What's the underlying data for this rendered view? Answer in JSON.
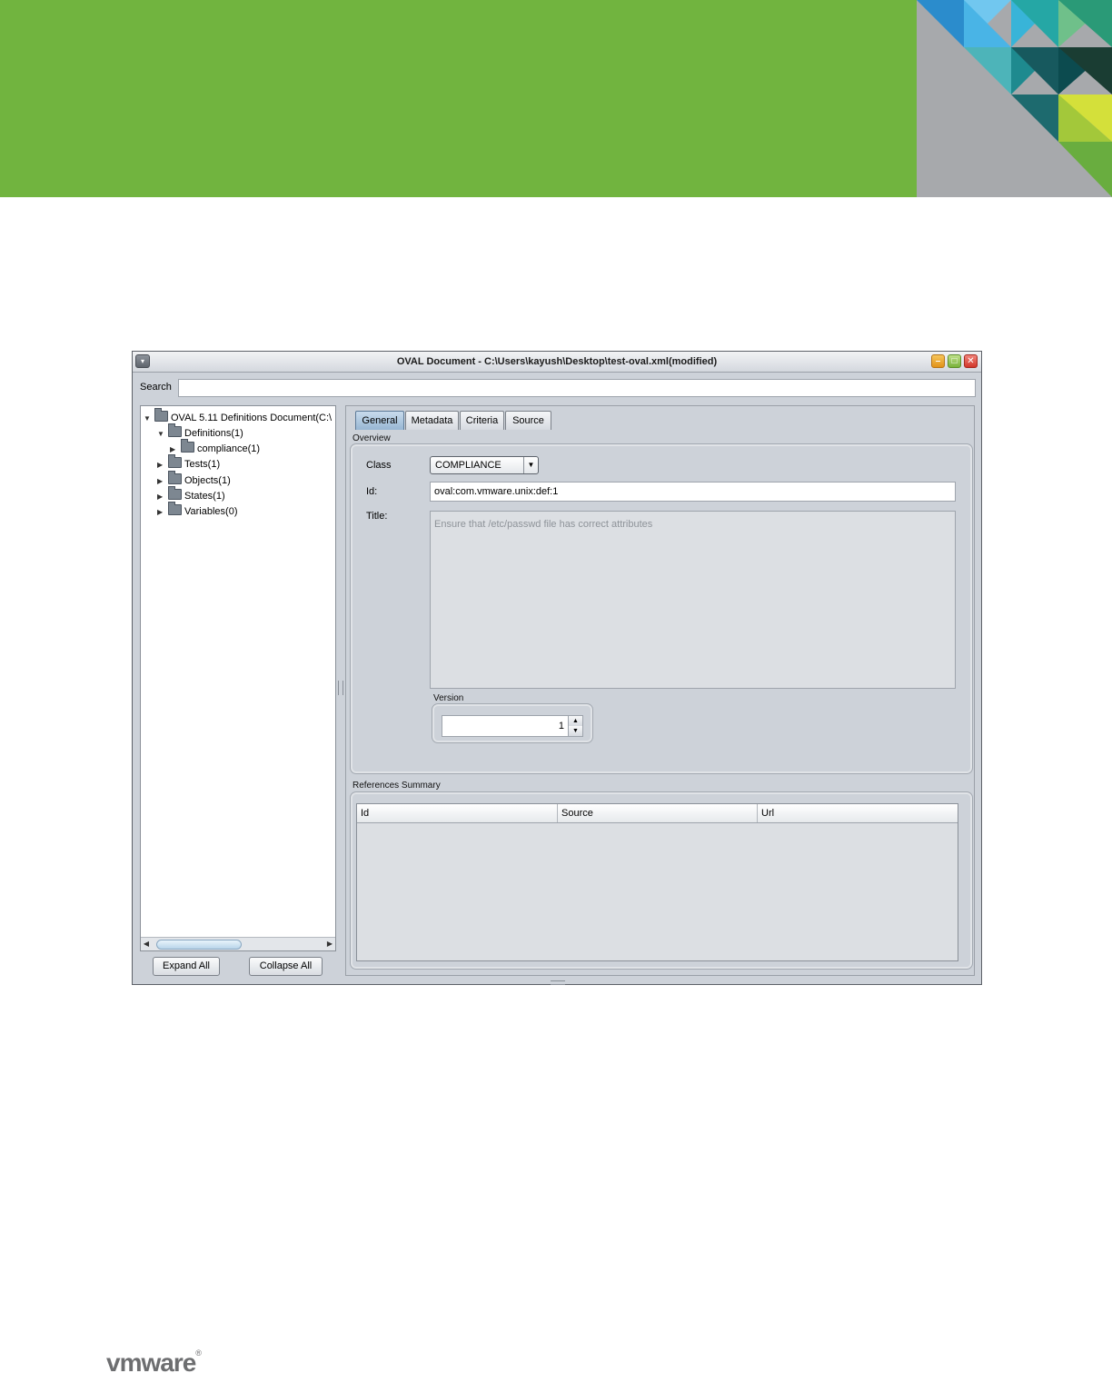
{
  "window": {
    "title": "OVAL Document - C:\\Users\\kayush\\Desktop\\test-oval.xml(modified)",
    "menu_icon": "chevron-down-icon",
    "minimize_glyph": "–",
    "maximize_glyph": "□",
    "close_glyph": "✕"
  },
  "search": {
    "label": "Search",
    "value": ""
  },
  "tree": {
    "root": "OVAL 5.11 Definitions Document(C:\\",
    "definitions": "Definitions(1)",
    "compliance": "compliance(1)",
    "tests": "Tests(1)",
    "objects": "Objects(1)",
    "states": "States(1)",
    "variables": "Variables(0)"
  },
  "buttons": {
    "expand_all": "Expand All",
    "collapse_all": "Collapse All"
  },
  "tabs": [
    "General",
    "Metadata",
    "Criteria",
    "Source"
  ],
  "overview": {
    "section": "Overview",
    "class_label": "Class",
    "class_value": "COMPLIANCE",
    "id_label": "Id:",
    "id_value": "oval:com.vmware.unix:def:1",
    "title_label": "Title:",
    "title_value": "Ensure that /etc/passwd file has correct attributes",
    "version_label": "Version",
    "version_value": "1"
  },
  "references": {
    "section": "References Summary",
    "columns": [
      "Id",
      "Source",
      "Url"
    ]
  },
  "brand": {
    "logo_text": "vmware",
    "reg": "®"
  },
  "colors": {
    "banner_green": "#71b43f",
    "window_bg": "#cdd2d9",
    "active_tab": "#97b6d3"
  }
}
